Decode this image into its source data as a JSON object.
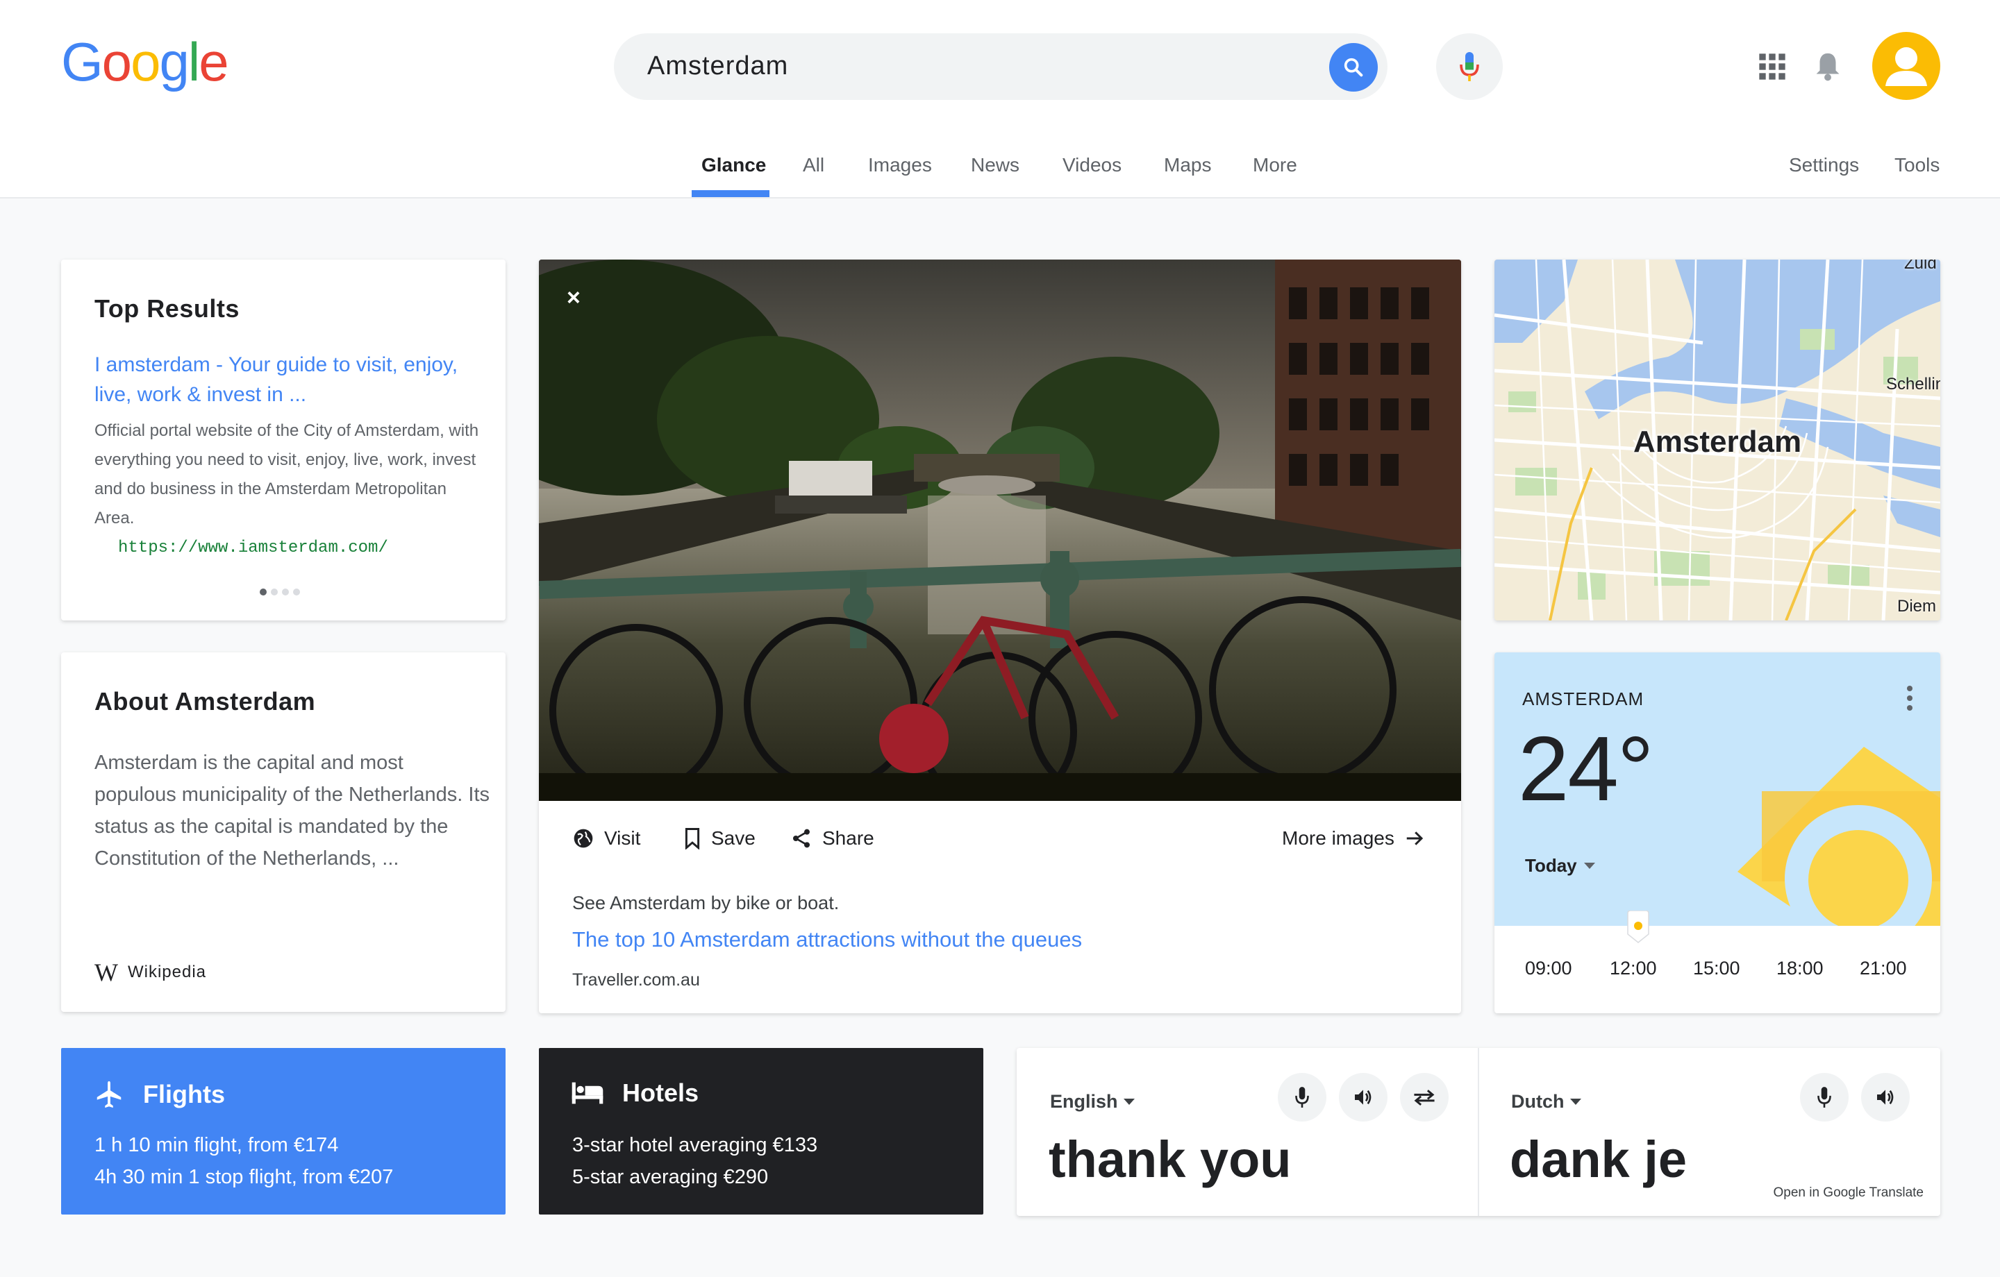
{
  "logo": {
    "letters": [
      "G",
      "o",
      "o",
      "g",
      "l",
      "e"
    ]
  },
  "colors": {
    "blue": "#4285f4",
    "red": "#ea4335",
    "yellow": "#fbbc04",
    "green": "#34a853",
    "link": "#4285f4",
    "url_green": "#188038"
  },
  "search": {
    "query": "Amsterdam"
  },
  "icons": {
    "search": "search-icon",
    "mic": "mic-icon",
    "apps": "apps-grid-icon",
    "notifications": "bell-icon",
    "account": "account-icon"
  },
  "nav": {
    "tabs": [
      "Glance",
      "All",
      "Images",
      "News",
      "Videos",
      "Maps",
      "More"
    ],
    "active": "Glance",
    "right": [
      "Settings",
      "Tools"
    ]
  },
  "top_results": {
    "title": "Top Results",
    "link_text": "I amsterdam - Your guide to visit, enjoy, live, work & invest in ...",
    "description": "Official portal website of the City of Amsterdam, with everything you need to visit, enjoy, live, work, invest and do business in the Amsterdam Metropolitan Area.",
    "url": "https://www.iamsterdam.com/",
    "pager_total": 4,
    "pager_current": 1
  },
  "about": {
    "title": "About Amsterdam",
    "description": "Amsterdam is the capital and most populous municipality of the Netherlands. Its status as the capital is mandated by the Constitution of the Netherlands, ...",
    "source_logo": "W",
    "source": "Wikipedia"
  },
  "image_card": {
    "close": "×",
    "actions": {
      "visit": "Visit",
      "save": "Save",
      "share": "Share",
      "more": "More images"
    },
    "caption": "See Amsterdam by bike or boat.",
    "link": "The top 10 Amsterdam attractions without the queues",
    "source": "Traveller.com.au"
  },
  "map": {
    "label": "Amsterdam",
    "edge_labels": {
      "top": "Zuid",
      "right": "Schellin",
      "bottom": "Diem"
    }
  },
  "weather": {
    "city": "AMSTERDAM",
    "temperature": "24°",
    "period": "Today",
    "times": [
      "09:00",
      "12:00",
      "15:00",
      "18:00",
      "21:00"
    ],
    "selected_time": "12:00"
  },
  "flights": {
    "title": "Flights",
    "lines": [
      "1 h 10 min flight, from €174",
      "4h 30 min 1 stop flight, from €207"
    ]
  },
  "hotels": {
    "title": "Hotels",
    "lines": [
      "3-star hotel averaging €133",
      "5-star averaging €290"
    ]
  },
  "translate": {
    "source_lang": "English",
    "target_lang": "Dutch",
    "source_text": "thank you",
    "target_text": "dank je",
    "open_link": "Open in Google Translate"
  }
}
